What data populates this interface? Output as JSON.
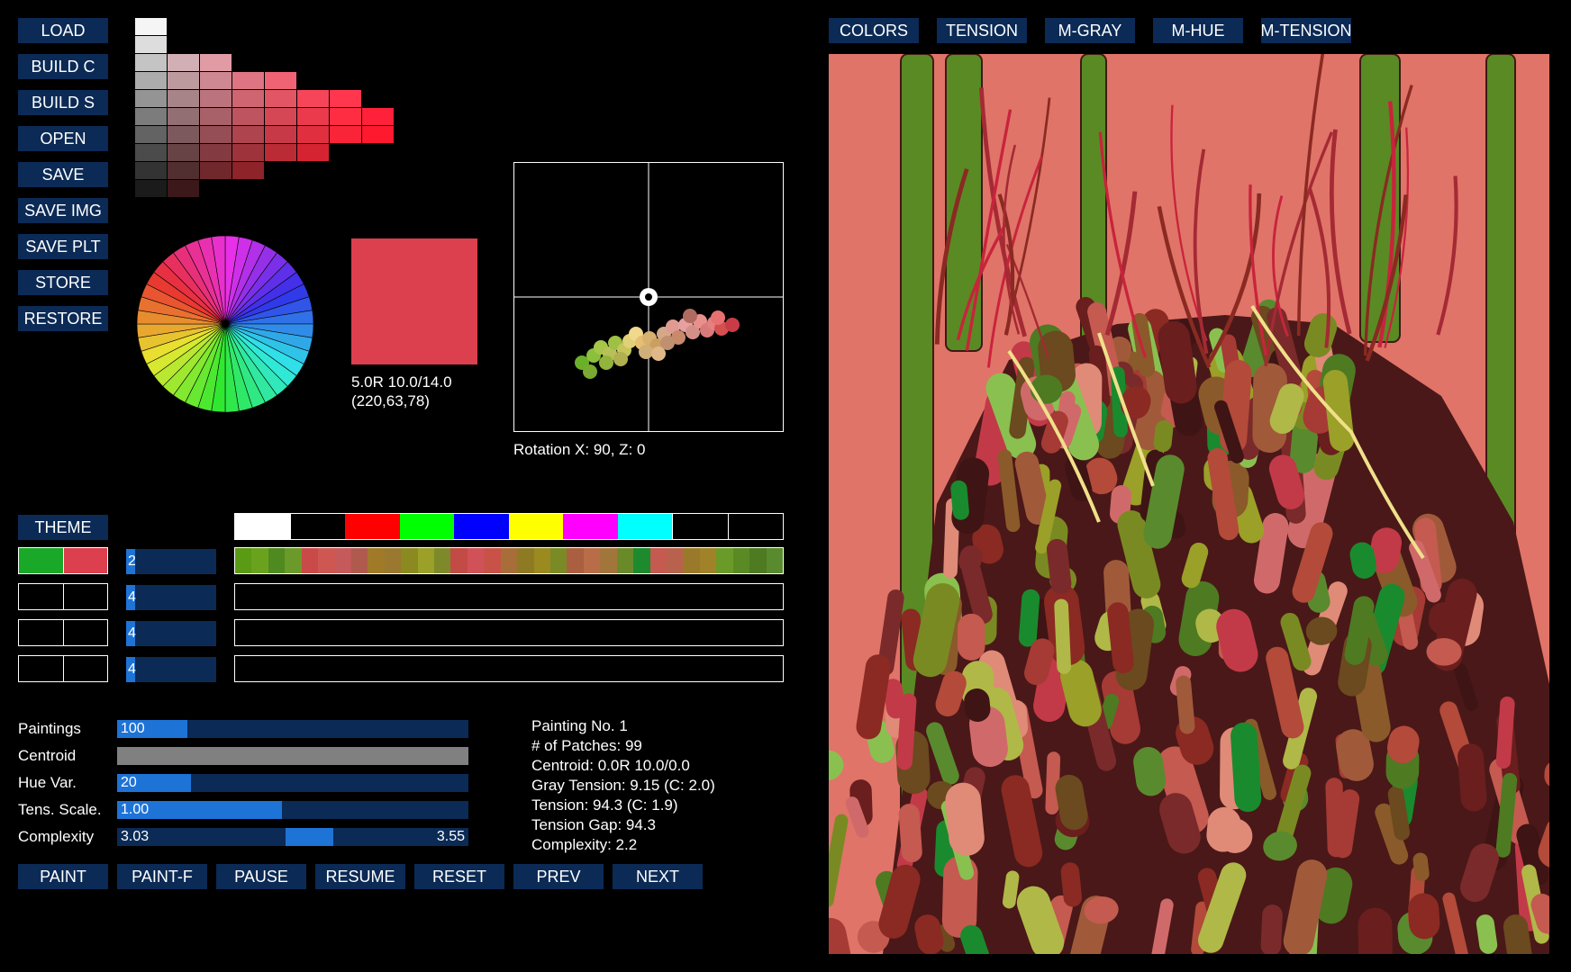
{
  "left_buttons": [
    "LOAD",
    "BUILD C",
    "BUILD S",
    "OPEN",
    "SAVE",
    "SAVE IMG",
    "SAVE PLT",
    "STORE",
    "RESTORE"
  ],
  "view_buttons": [
    "COLORS",
    "TENSION",
    "M-GRAY",
    "M-HUE",
    "M-TENSION"
  ],
  "swatch": {
    "color": "#dc3f4e",
    "munsell": "5.0R 10.0/14.0",
    "rgb": "(220,63,78)"
  },
  "rotation_label": "Rotation X: 90, Z: 0",
  "theme_label": "THEME",
  "theme_colors": [
    "#ffffff",
    "#000000",
    "#ff0000",
    "#00ff00",
    "#0000ff",
    "#ffff00",
    "#ff00ff",
    "#00ffff",
    "#000000",
    "#000000"
  ],
  "palette_rows": [
    {
      "pair": [
        "#1aa828",
        "#dc3f4e"
      ],
      "count": "2",
      "strip": [
        "#5a9a14",
        "#6aa21e",
        "#4f8a20",
        "#6b9a2a",
        "#c94a48",
        "#cf5752",
        "#c55a5a",
        "#b05a4e",
        "#a07a28",
        "#9a7830",
        "#8a8a20",
        "#9aa028",
        "#7e8a2a",
        "#c24b45",
        "#d05258",
        "#c85248",
        "#a86e3a",
        "#8f7a24",
        "#9a8a20",
        "#7a8a24",
        "#aa6040",
        "#b86c48",
        "#a2763a",
        "#6a8a2a",
        "#1e8a2e",
        "#c45a50",
        "#b8624e",
        "#9a7a2a",
        "#a08228",
        "#6a9a28",
        "#5a8a24",
        "#4e7a22",
        "#5a8a2e"
      ]
    },
    {
      "pair": [
        "#000000",
        "#000000"
      ],
      "count": "4",
      "strip": []
    },
    {
      "pair": [
        "#000000",
        "#000000"
      ],
      "count": "4",
      "strip": []
    },
    {
      "pair": [
        "#000000",
        "#000000"
      ],
      "count": "4",
      "strip": []
    }
  ],
  "sliders": [
    {
      "label": "Paintings",
      "value": "100",
      "fill": 0.2
    },
    {
      "label": "Centroid",
      "value": "",
      "fill": 1.0,
      "gray": true
    },
    {
      "label": "Hue Var.",
      "value": "20",
      "fill": 0.21
    },
    {
      "label": "Tens. Scale.",
      "value": "1.00",
      "fill": 0.47
    },
    {
      "label": "Complexity",
      "value": "3.03",
      "value2": "3.55",
      "range": [
        0.48,
        0.615
      ]
    }
  ],
  "info": [
    "Painting No. 1",
    "# of Patches: 99",
    "Centroid: 0.0R 10.0/0.0",
    "Gray Tension: 9.15 (C: 2.0)",
    "Tension: 94.3 (C: 1.9)",
    "Tension Gap: 94.3",
    "Complexity: 2.2"
  ],
  "bottom_buttons": [
    "PAINT",
    "PAINT-F",
    "PAUSE",
    "RESUME",
    "RESET",
    "PREV",
    "NEXT"
  ],
  "colors": {
    "button": "#0b2a55",
    "accent": "#1e73d6",
    "canvas_bg": "#e07468"
  }
}
